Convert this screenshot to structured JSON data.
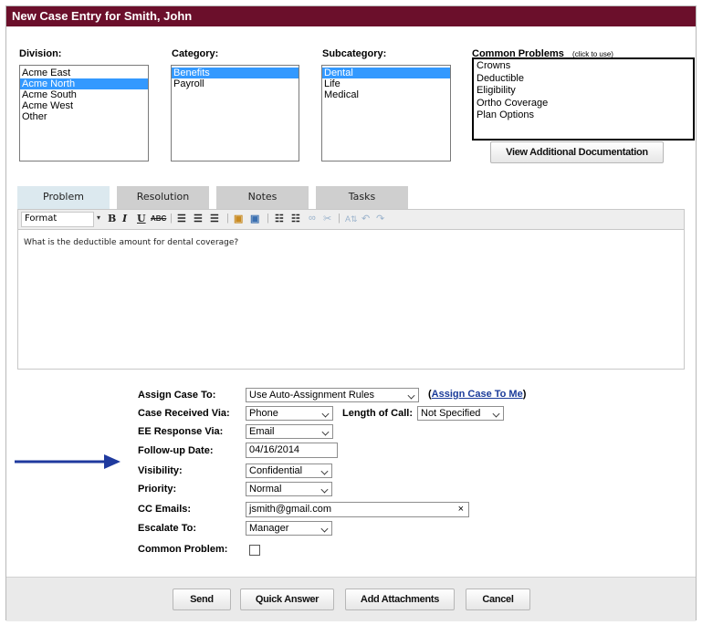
{
  "window": {
    "title": "New Case Entry for Smith, John"
  },
  "division": {
    "label": "Division:",
    "options": [
      "Acme East",
      "Acme North",
      "Acme South",
      "Acme West",
      "Other"
    ],
    "selected": "Acme North"
  },
  "category": {
    "label": "Category:",
    "options": [
      "Benefits",
      "Payroll"
    ],
    "selected": "Benefits"
  },
  "subcategory": {
    "label": "Subcategory:",
    "options": [
      "Dental",
      "Life",
      "Medical"
    ],
    "selected": "Dental"
  },
  "common_problems": {
    "label": "Common Problems",
    "hint": "(click to use)",
    "items": [
      "Crowns",
      "Deductible",
      "Eligibility",
      "Ortho Coverage",
      "Plan Options"
    ],
    "doc_button": "View Additional Documentation"
  },
  "tabs": [
    {
      "label": "Problem",
      "active": true
    },
    {
      "label": "Resolution",
      "active": false
    },
    {
      "label": "Notes",
      "active": false
    },
    {
      "label": "Tasks",
      "active": false
    }
  ],
  "editor": {
    "format_label": "Format",
    "content": "What is the deductible amount for dental coverage?"
  },
  "form": {
    "assign_case_to": {
      "label": "Assign Case To:",
      "value": "Use Auto-Assignment Rules",
      "link_text": "Assign Case To Me"
    },
    "case_received_via": {
      "label": "Case Received Via:",
      "value": "Phone"
    },
    "length_of_call": {
      "label": "Length of Call:",
      "value": "Not Specified"
    },
    "ee_response_via": {
      "label": "EE Response Via:",
      "value": "Email"
    },
    "follow_up_date": {
      "label": "Follow-up Date:",
      "value": "04/16/2014"
    },
    "visibility": {
      "label": "Visibility:",
      "value": "Confidential"
    },
    "priority": {
      "label": "Priority:",
      "value": "Normal"
    },
    "cc_emails": {
      "label": "CC Emails:",
      "value": "jsmith@gmail.com",
      "clear_glyph": "×"
    },
    "escalate_to": {
      "label": "Escalate To:",
      "value": "Manager"
    },
    "common_problem": {
      "label": "Common Problem:",
      "checked": false
    }
  },
  "footer": {
    "send": "Send",
    "quick_answer": "Quick Answer",
    "add_attachments": "Add Attachments",
    "cancel": "Cancel"
  },
  "colors": {
    "title_bar": "#6b0f2b",
    "selection": "#3399ff",
    "annotation_arrow": "#1f3a9e",
    "link": "#1a3b9a"
  }
}
